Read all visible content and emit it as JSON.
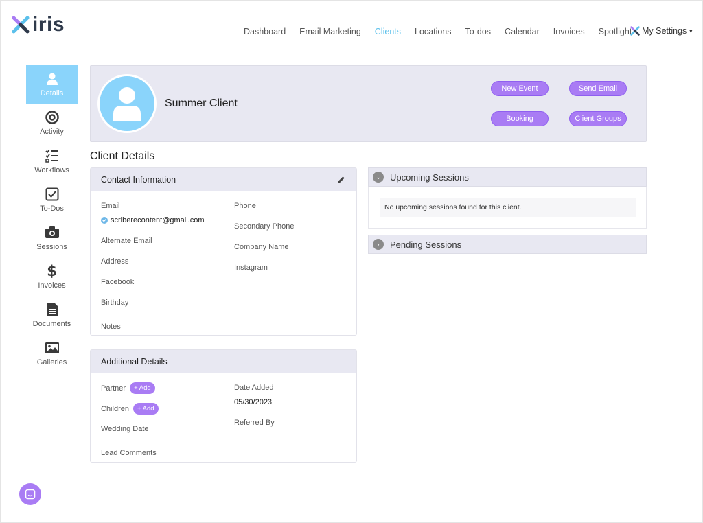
{
  "brand": {
    "name": "iris"
  },
  "nav": {
    "items": [
      {
        "label": "Dashboard",
        "active": false
      },
      {
        "label": "Email Marketing",
        "active": false
      },
      {
        "label": "Clients",
        "active": true
      },
      {
        "label": "Locations",
        "active": false
      },
      {
        "label": "To-dos",
        "active": false
      },
      {
        "label": "Calendar",
        "active": false
      },
      {
        "label": "Invoices",
        "active": false
      },
      {
        "label": "Spotlight",
        "active": false
      }
    ],
    "settings_label": "My Settings"
  },
  "sidebar": {
    "items": [
      {
        "label": "Details",
        "icon": "person-icon",
        "active": true
      },
      {
        "label": "Activity",
        "icon": "target-icon",
        "active": false
      },
      {
        "label": "Workflows",
        "icon": "checklist-icon",
        "active": false
      },
      {
        "label": "To-Dos",
        "icon": "checkbox-icon",
        "active": false
      },
      {
        "label": "Sessions",
        "icon": "camera-icon",
        "active": false
      },
      {
        "label": "Invoices",
        "icon": "dollar-icon",
        "active": false
      },
      {
        "label": "Documents",
        "icon": "document-icon",
        "active": false
      },
      {
        "label": "Galleries",
        "icon": "image-icon",
        "active": false
      }
    ]
  },
  "profile": {
    "name": "Summer Client",
    "buttons": {
      "new_event": "New Event",
      "send_email": "Send Email",
      "booking": "Booking",
      "client_groups": "Client Groups"
    }
  },
  "client_details": {
    "title": "Client Details",
    "contact": {
      "title": "Contact Information",
      "email_label": "Email",
      "email_value": "scriberecontent@gmail.com",
      "alt_email_label": "Alternate Email",
      "address_label": "Address",
      "facebook_label": "Facebook",
      "birthday_label": "Birthday",
      "notes_label": "Notes",
      "phone_label": "Phone",
      "secondary_phone_label": "Secondary Phone",
      "company_label": "Company Name",
      "instagram_label": "Instagram"
    },
    "additional": {
      "title": "Additional Details",
      "partner_label": "Partner",
      "children_label": "Children",
      "add_label": "+ Add",
      "wedding_label": "Wedding Date",
      "lead_comments_label": "Lead Comments",
      "date_added_label": "Date Added",
      "date_added_value": "05/30/2023",
      "referred_label": "Referred By"
    }
  },
  "sessions": {
    "upcoming_title": "Upcoming Sessions",
    "upcoming_empty": "No upcoming sessions found for this client.",
    "pending_title": "Pending Sessions"
  },
  "colors": {
    "accent": "#5bc0eb",
    "sidebar_active": "#8ad4fb",
    "button_purple": "#a97cf4",
    "panel_bg": "#e8e8f2"
  }
}
